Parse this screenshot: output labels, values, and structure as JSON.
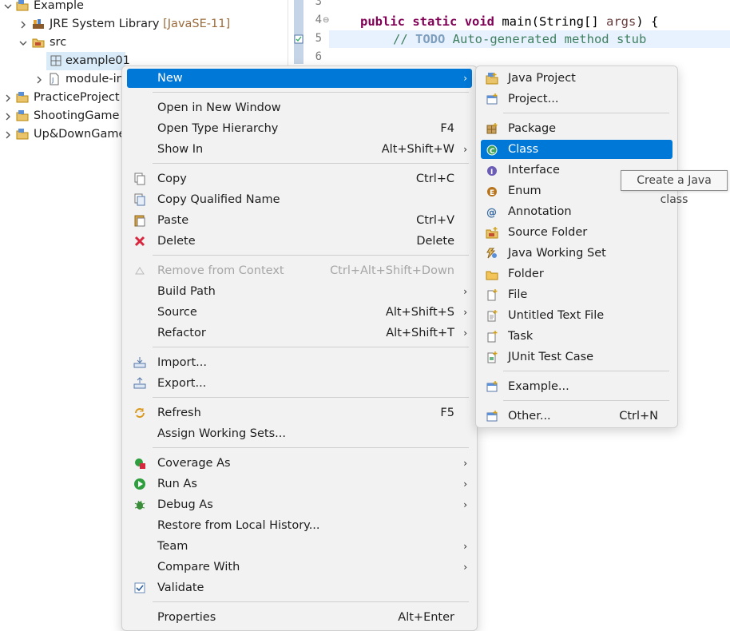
{
  "explorer": {
    "items": [
      {
        "label": "Example",
        "decoration": ""
      },
      {
        "label": "JRE System Library",
        "decoration": "[JavaSE-11]"
      },
      {
        "label": "src",
        "decoration": ""
      },
      {
        "label": "example01",
        "decoration": ""
      },
      {
        "label": "module-in",
        "decoration": ""
      },
      {
        "label": "PracticeProject",
        "decoration": ""
      },
      {
        "label": "ShootingGame",
        "decoration": ""
      },
      {
        "label": "Up&DownGame",
        "decoration": ""
      }
    ]
  },
  "editor": {
    "line_numbers": [
      "3",
      "4",
      "5",
      "6"
    ],
    "method_line": {
      "kw1": "public",
      "kw2": "static",
      "kw3": "void",
      "rest": " main(String[] ",
      "arg": "args",
      "end": ") {"
    },
    "comment_line": {
      "prefix": "// ",
      "todo": "TODO",
      "text": " Auto-generated method stub"
    }
  },
  "context_menu": {
    "items": [
      {
        "label": "New",
        "shortcut": "",
        "submenu": true
      },
      {
        "label": "Open in New Window",
        "shortcut": ""
      },
      {
        "label": "Open Type Hierarchy",
        "shortcut": "F4"
      },
      {
        "label": "Show In",
        "shortcut": "Alt+Shift+W",
        "submenu": true
      },
      {
        "label": "Copy",
        "shortcut": "Ctrl+C"
      },
      {
        "label": "Copy Qualified Name",
        "shortcut": ""
      },
      {
        "label": "Paste",
        "shortcut": "Ctrl+V"
      },
      {
        "label": "Delete",
        "shortcut": "Delete"
      },
      {
        "label": "Remove from Context",
        "shortcut": "Ctrl+Alt+Shift+Down",
        "disabled": true
      },
      {
        "label": "Build Path",
        "shortcut": "",
        "submenu": true
      },
      {
        "label": "Source",
        "shortcut": "Alt+Shift+S",
        "submenu": true
      },
      {
        "label": "Refactor",
        "shortcut": "Alt+Shift+T",
        "submenu": true
      },
      {
        "label": "Import...",
        "shortcut": ""
      },
      {
        "label": "Export...",
        "shortcut": ""
      },
      {
        "label": "Refresh",
        "shortcut": "F5"
      },
      {
        "label": "Assign Working Sets...",
        "shortcut": ""
      },
      {
        "label": "Coverage As",
        "shortcut": "",
        "submenu": true
      },
      {
        "label": "Run As",
        "shortcut": "",
        "submenu": true
      },
      {
        "label": "Debug As",
        "shortcut": "",
        "submenu": true
      },
      {
        "label": "Restore from Local History...",
        "shortcut": ""
      },
      {
        "label": "Team",
        "shortcut": "",
        "submenu": true
      },
      {
        "label": "Compare With",
        "shortcut": "",
        "submenu": true
      },
      {
        "label": "Validate",
        "shortcut": ""
      },
      {
        "label": "Properties",
        "shortcut": "Alt+Enter"
      }
    ],
    "arrow_glyph": "›"
  },
  "new_submenu": {
    "items": [
      {
        "label": "Java Project",
        "shortcut": ""
      },
      {
        "label": "Project...",
        "shortcut": ""
      },
      {
        "label": "Package",
        "shortcut": ""
      },
      {
        "label": "Class",
        "shortcut": "",
        "highlighted": true
      },
      {
        "label": "Interface",
        "shortcut": ""
      },
      {
        "label": "Enum",
        "shortcut": ""
      },
      {
        "label": "Annotation",
        "shortcut": ""
      },
      {
        "label": "Source Folder",
        "shortcut": ""
      },
      {
        "label": "Java Working Set",
        "shortcut": ""
      },
      {
        "label": "Folder",
        "shortcut": ""
      },
      {
        "label": "File",
        "shortcut": ""
      },
      {
        "label": "Untitled Text File",
        "shortcut": ""
      },
      {
        "label": "Task",
        "shortcut": ""
      },
      {
        "label": "JUnit Test Case",
        "shortcut": ""
      },
      {
        "label": "Example...",
        "shortcut": ""
      },
      {
        "label": "Other...",
        "shortcut": "Ctrl+N"
      }
    ]
  },
  "tooltip": {
    "text": "Create a Java class"
  },
  "colors": {
    "highlight": "#0078d7",
    "keyword": "#7f0055",
    "comment": "#3f7f5f"
  }
}
